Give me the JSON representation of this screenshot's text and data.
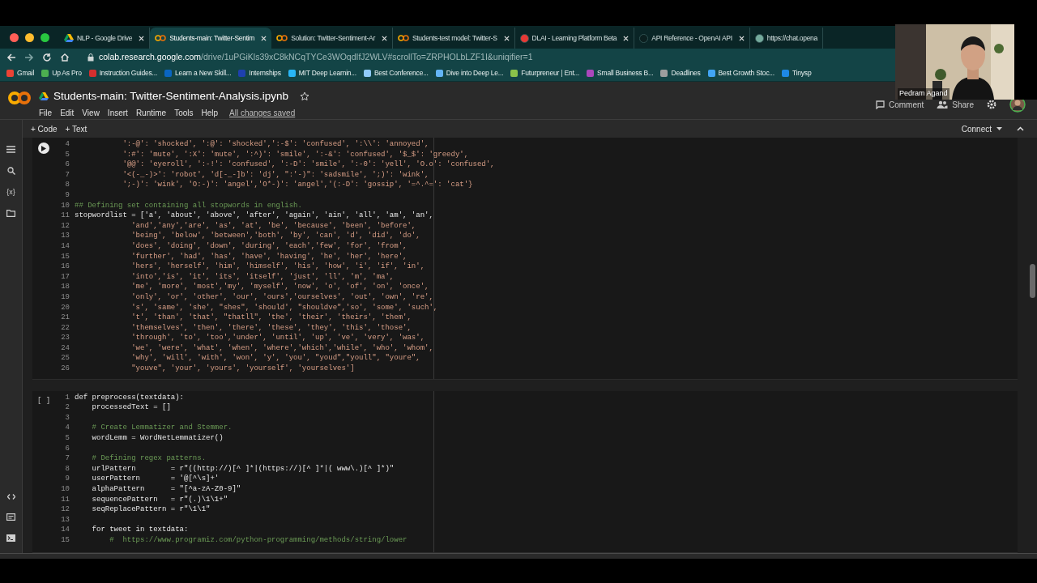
{
  "tabs": [
    {
      "label": "NLP - Google Drive",
      "selected": false
    },
    {
      "label": "Students-main: Twitter-Sentim",
      "selected": true
    },
    {
      "label": "Solution: Twitter-Sentiment-Ar",
      "selected": false
    },
    {
      "label": "Students-test model: Twitter-S",
      "selected": false
    },
    {
      "label": "DLAI - Learning Platform Beta",
      "selected": false
    },
    {
      "label": "API Reference - OpenAI API",
      "selected": false
    },
    {
      "label": "https://chat.opena",
      "selected": false
    }
  ],
  "address": {
    "host": "colab.research.google.com",
    "path": "/drive/1uPGiKls39xC8kNCqTYCe3WOqdIfJ2WLV#scrollTo=ZRPHOLbLZF1I&uniqifier=1"
  },
  "bookmarks": [
    {
      "label": "Gmail",
      "color": "#ea4335"
    },
    {
      "label": "Up As Pro",
      "color": "#4caf50"
    },
    {
      "label": "Instruction Guides...",
      "color": "#d32f2f"
    },
    {
      "label": "Learn a New Skill...",
      "color": "#0a66c2"
    },
    {
      "label": "Internships",
      "color": "#1e40af"
    },
    {
      "label": "MIT Deep Learnin...",
      "color": "#29b6f6"
    },
    {
      "label": "Best Conference...",
      "color": "#90caf9"
    },
    {
      "label": "Dive into Deep Le...",
      "color": "#64b5f6"
    },
    {
      "label": "Futurpreneur | Ent...",
      "color": "#8bc34a"
    },
    {
      "label": "Small Business B...",
      "color": "#ab47bc"
    },
    {
      "label": "Deadlines",
      "color": "#9e9e9e"
    },
    {
      "label": "Best Growth Stoc...",
      "color": "#42a5f5"
    },
    {
      "label": "Tinysp",
      "color": "#1e88e5"
    }
  ],
  "notebook": {
    "title": "Students-main: Twitter-Sentiment-Analysis.ipynb",
    "starred": false,
    "menu": [
      "File",
      "Edit",
      "View",
      "Insert",
      "Runtime",
      "Tools",
      "Help"
    ],
    "save_status": "All changes saved",
    "comment": "Comment",
    "share": "Share",
    "add_code": "+ Code",
    "add_text": "+ Text",
    "connect": "Connect"
  },
  "sidebar": {
    "variables_label": "{x}"
  },
  "webcam": {
    "name": "Pedram Agand"
  },
  "cells": [
    {
      "kind": "ran",
      "lines": [
        {
          "n": "4",
          "kind": "string",
          "text": "           ':-@': 'shocked', ':@': 'shocked',':-$': 'confused', ':\\\\': 'annoyed',"
        },
        {
          "n": "5",
          "kind": "string",
          "text": "           ':#': 'mute', ':X': 'mute', ':^)': 'smile', ':-&': 'confused', '$_$': 'greedy',"
        },
        {
          "n": "6",
          "kind": "string",
          "text": "           '@@': 'eyeroll', ':-!': 'confused', ':-D': 'smile', ':-0': 'yell', 'O.o': 'confused',"
        },
        {
          "n": "7",
          "kind": "string",
          "text": "           '<(-_-)>': 'robot', 'd[-_-]b': 'dj', \":'-)\": 'sadsmile', ';)': 'wink',"
        },
        {
          "n": "8",
          "kind": "string",
          "text": "           ';-)': 'wink', 'O:-)': 'angel','O*-)': 'angel','(:-D': 'gossip', '=^.^=': 'cat'}"
        },
        {
          "n": "9",
          "kind": "code"
        },
        {
          "n": "10",
          "kind": "comment",
          "text": "## Defining set containing all stopwords in english."
        },
        {
          "n": "11",
          "kind": "code",
          "text": "stopwordlist = ['a', 'about', 'above', 'after', 'again', 'ain', 'all', 'am', 'an',"
        },
        {
          "n": "12",
          "kind": "string",
          "text": "             'and','any','are', 'as', 'at', 'be', 'because', 'been', 'before',"
        },
        {
          "n": "13",
          "kind": "string",
          "text": "             'being', 'below', 'between','both', 'by', 'can', 'd', 'did', 'do',"
        },
        {
          "n": "14",
          "kind": "string",
          "text": "             'does', 'doing', 'down', 'during', 'each','few', 'for', 'from',"
        },
        {
          "n": "15",
          "kind": "string",
          "text": "             'further', 'had', 'has', 'have', 'having', 'he', 'her', 'here',"
        },
        {
          "n": "16",
          "kind": "string",
          "text": "             'hers', 'herself', 'him', 'himself', 'his', 'how', 'i', 'if', 'in',"
        },
        {
          "n": "17",
          "kind": "string",
          "text": "             'into','is', 'it', 'its', 'itself', 'just', 'll', 'm', 'ma',"
        },
        {
          "n": "18",
          "kind": "string",
          "text": "             'me', 'more', 'most','my', 'myself', 'now', 'o', 'of', 'on', 'once',"
        },
        {
          "n": "19",
          "kind": "string",
          "text": "             'only', 'or', 'other', 'our', 'ours','ourselves', 'out', 'own', 're',"
        },
        {
          "n": "20",
          "kind": "string",
          "text": "             's', 'same', 'she', \"shes\", 'should', \"shouldve\",'so', 'some', 'such',"
        },
        {
          "n": "21",
          "kind": "string",
          "text": "             't', 'than', 'that', \"thatll\", 'the', 'their', 'theirs', 'them',"
        },
        {
          "n": "22",
          "kind": "string",
          "text": "             'themselves', 'then', 'there', 'these', 'they', 'this', 'those',"
        },
        {
          "n": "23",
          "kind": "string",
          "text": "             'through', 'to', 'too','under', 'until', 'up', 've', 'very', 'was',"
        },
        {
          "n": "24",
          "kind": "string",
          "text": "             'we', 'were', 'what', 'when', 'where','which','while', 'who', 'whom',"
        },
        {
          "n": "25",
          "kind": "string",
          "text": "             'why', 'will', 'with', 'won', 'y', 'you', \"youd\",\"youll\", \"youre\","
        },
        {
          "n": "26",
          "kind": "string",
          "text": "             \"youve\", 'your', 'yours', 'yourself', 'yourselves']"
        }
      ]
    },
    {
      "kind": "idle",
      "marker": "[ ]",
      "lines": [
        {
          "n": "1",
          "kind": "code",
          "text": "def preprocess(textdata):"
        },
        {
          "n": "2",
          "kind": "code",
          "text": "    processedText = []"
        },
        {
          "n": "3",
          "kind": "code"
        },
        {
          "n": "4",
          "kind": "comment",
          "text": "    # Create Lemmatizer and Stemmer."
        },
        {
          "n": "5",
          "kind": "code",
          "text": "    wordLemm = WordNetLemmatizer()"
        },
        {
          "n": "6",
          "kind": "code"
        },
        {
          "n": "7",
          "kind": "comment",
          "text": "    # Defining regex patterns."
        },
        {
          "n": "8",
          "kind": "code",
          "text": "    urlPattern        = r\"((http://)[^ ]*|(https://)[^ ]*|( www\\.)[^ ]*)\""
        },
        {
          "n": "9",
          "kind": "code",
          "text": "    userPattern       = '@[^\\s]+'"
        },
        {
          "n": "10",
          "kind": "code",
          "text": "    alphaPattern      = \"[^a-zA-Z0-9]\""
        },
        {
          "n": "11",
          "kind": "code",
          "text": "    sequencePattern   = r\"(.)\\1\\1+\""
        },
        {
          "n": "12",
          "kind": "code",
          "text": "    seqReplacePattern = r\"\\1\\1\""
        },
        {
          "n": "13",
          "kind": "code"
        },
        {
          "n": "14",
          "kind": "code",
          "text": "    for tweet in textdata:"
        },
        {
          "n": "15",
          "kind": "comment",
          "text": "        #  https://www.programiz.com/python-programming/methods/string/lower"
        }
      ]
    }
  ]
}
